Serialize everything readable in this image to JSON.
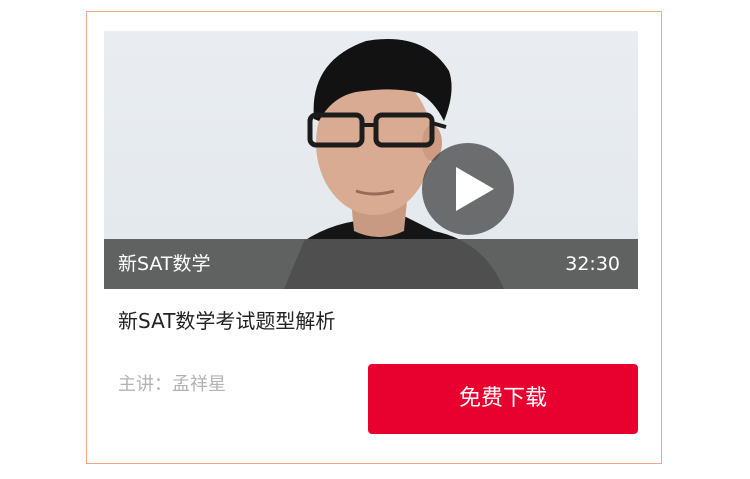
{
  "card": {
    "video": {
      "thumbnail": "instructor-photo",
      "play_icon": "play-icon",
      "overlay_title": "新SAT数学",
      "duration": "32:30"
    },
    "course_title": "新SAT数学考试题型解析",
    "instructor_label": "主讲：孟祥星",
    "download_button": "免费下载"
  },
  "colors": {
    "accent": "#e8002e",
    "card_border": "#f4a88a",
    "overlay": "#555555",
    "muted_text": "#b3b3b3"
  }
}
